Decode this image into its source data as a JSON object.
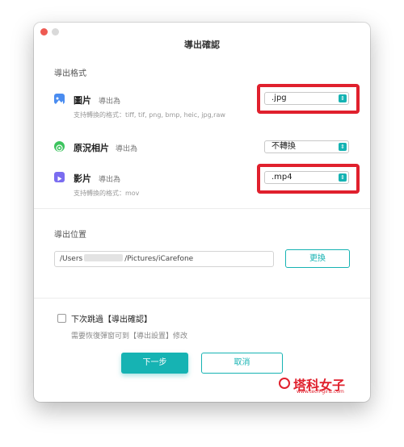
{
  "dialog": {
    "title": "導出確認"
  },
  "format_section": {
    "title": "導出格式",
    "rows": [
      {
        "label": "圖片",
        "export_as": "導出為",
        "selected": ".jpg",
        "hint": "支持轉換的格式：tiff, tif, png, bmp, heic, jpg,raw",
        "icon": "image-icon"
      },
      {
        "label": "原況相片",
        "export_as": "導出為",
        "selected": "不轉換",
        "hint": "",
        "icon": "live-photo-icon"
      },
      {
        "label": "影片",
        "export_as": "導出為",
        "selected": ".mp4",
        "hint": "支持轉換的格式：mov",
        "icon": "video-icon"
      }
    ]
  },
  "location_section": {
    "title": "導出位置",
    "path_prefix": "/Users",
    "path_suffix": "/Pictures/iCarefone",
    "change_label": "更換"
  },
  "skip": {
    "label": "下次跳過【導出確認】",
    "hint": "需要恢復彈窗可到【導出設置】修改"
  },
  "buttons": {
    "next": "下一步",
    "cancel": "取消"
  },
  "watermark": {
    "text": "塔科女子",
    "url": "www.tech-girlz.com"
  },
  "colors": {
    "accent": "#16b3b3",
    "highlight": "#e0202d",
    "close_dot": "#ee5a52"
  }
}
